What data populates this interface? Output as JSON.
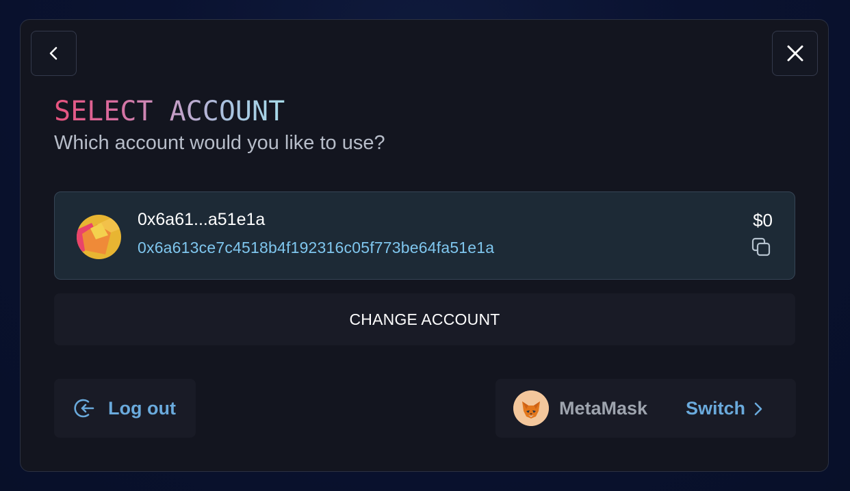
{
  "header": {
    "back_icon": "chevron-left-icon",
    "close_icon": "close-icon"
  },
  "title": {
    "part1": "SELECT",
    "part2": "ACCOUNT",
    "subtitle": "Which account would you like to use?"
  },
  "account": {
    "short_address": "0x6a61...a51e1a",
    "full_address": "0x6a613ce7c4518b4f192316c05f773be64fa51e1a",
    "balance": "$0",
    "copy_icon": "copy-icon"
  },
  "actions": {
    "change_account_label": "CHANGE ACCOUNT",
    "logout_label": "Log out",
    "logout_icon": "logout-icon"
  },
  "wallet": {
    "name": "MetaMask",
    "switch_label": "Switch",
    "logo_icon": "metamask-fox-icon"
  },
  "colors": {
    "modal_bg": "#13151f",
    "card_bg": "#1d2a36",
    "accent_blue": "#6aaadc",
    "address_blue": "#7fc6ee",
    "title_gradient_start": "#e8527d",
    "title_gradient_end": "#a7dbe9"
  }
}
